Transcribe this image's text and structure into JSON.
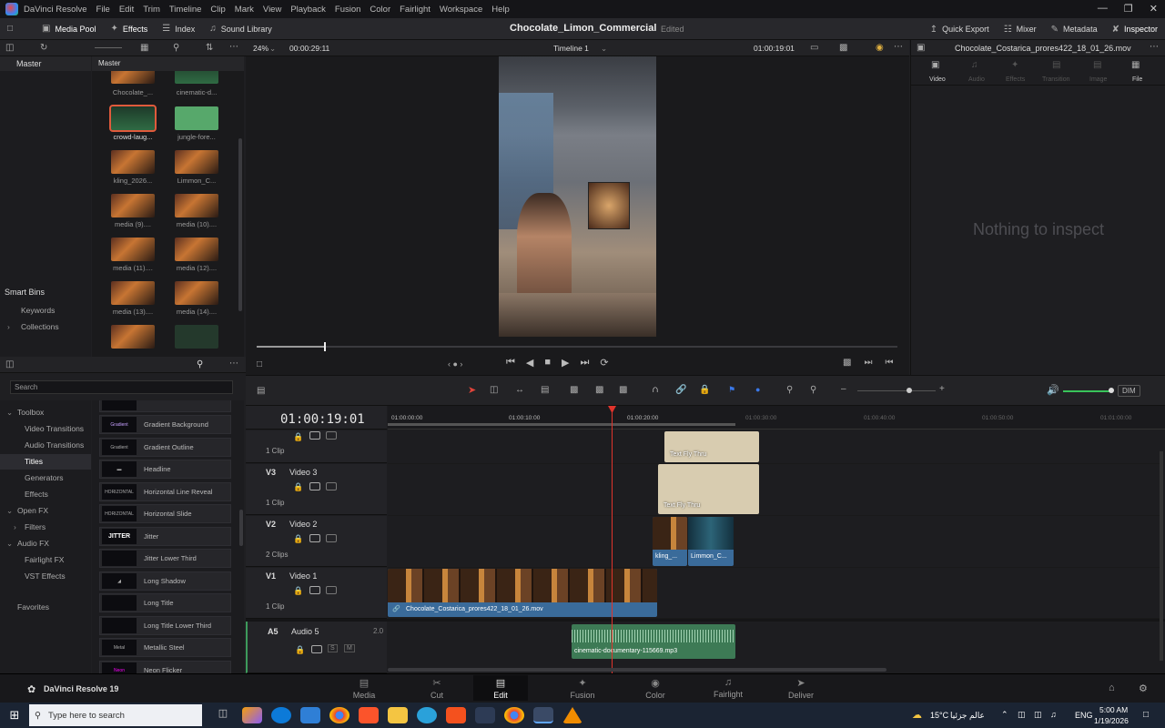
{
  "menubar": {
    "app_name": "DaVinci Resolve",
    "items": [
      "File",
      "Edit",
      "Trim",
      "Timeline",
      "Clip",
      "Mark",
      "View",
      "Playback",
      "Fusion",
      "Color",
      "Fairlight",
      "Workspace",
      "Help"
    ]
  },
  "toolbar": {
    "media_pool": "Media Pool",
    "effects": "Effects",
    "index": "Index",
    "sound_library": "Sound Library",
    "project_title": "Chocolate_Limon_Commercial",
    "project_status": "Edited",
    "quick_export": "Quick Export",
    "mixer": "Mixer",
    "metadata": "Metadata",
    "inspector": "Inspector"
  },
  "viewer": {
    "zoom": "24%",
    "duration": "00:00:29:11",
    "timeline_name": "Timeline 1",
    "timecode": "01:00:19:01",
    "playhead_fraction": 0.105
  },
  "inspector": {
    "clip_name": "Chocolate_Costarica_prores422_18_01_26.mov",
    "tabs": [
      "Video",
      "Audio",
      "Effects",
      "Transition",
      "Image",
      "File"
    ],
    "empty_message": "Nothing to inspect"
  },
  "media_pool": {
    "bin_header": "Master",
    "grid_header": "Master",
    "smart_bins": "Smart Bins",
    "keywords": "Keywords",
    "collections": "Collections",
    "clips": [
      "Chocolate_...",
      "cinematic-d...",
      "crowd-laug...",
      "jungle-fore...",
      "kling_2026...",
      "Limmon_C...",
      "media (9)....",
      "media (10)....",
      "media (11)....",
      "media (12)....",
      "media (13)....",
      "media (14)...."
    ]
  },
  "effects": {
    "search_placeholder": "Search",
    "tree": [
      "Toolbox",
      "Video Transitions",
      "Audio Transitions",
      "Titles",
      "Generators",
      "Effects",
      "Open FX",
      "Filters",
      "Audio FX",
      "Fairlight FX",
      "VST Effects",
      "Favorites"
    ],
    "items": [
      "Gradient Background",
      "Gradient Outline",
      "Headline",
      "Horizontal Line Reveal",
      "Horizontal Slide",
      "Jitter",
      "Jitter Lower Third",
      "Long Shadow",
      "Long Title",
      "Long Title Lower Third",
      "Metallic Steel",
      "Neon Flicker"
    ]
  },
  "timeline": {
    "timecode": "01:00:19:01",
    "ruler": [
      "01:00:00:00",
      "01:00:10:00",
      "01:00:20:00",
      "01:00:30:00",
      "01:00:40:00",
      "01:00:50:00",
      "01:01:00:00"
    ],
    "tracks": [
      {
        "id": "",
        "name": "",
        "clips": "1 Clip"
      },
      {
        "id": "V3",
        "name": "Video 3",
        "clips": "1 Clip"
      },
      {
        "id": "V2",
        "name": "Video 2",
        "clips": "2 Clips"
      },
      {
        "id": "V1",
        "name": "Video 1",
        "clips": "1 Clip"
      },
      {
        "id": "A5",
        "name": "Audio 5",
        "clips": "2.0"
      }
    ],
    "clip_labels": {
      "title1": "Text Fly Thru",
      "title2": "Text Fly Thru",
      "v2a": "kling_...",
      "v2b": "Limmon_C...",
      "v1": "Chocolate_Costarica_prores422_18_01_26.mov",
      "a5": "cinematic-documentary-115669.mp3"
    },
    "dim": "DIM"
  },
  "pages": {
    "app_version": "DaVinci Resolve 19",
    "tabs": [
      "Media",
      "Cut",
      "Edit",
      "Fusion",
      "Color",
      "Fairlight",
      "Deliver"
    ],
    "active": "Edit"
  },
  "taskbar": {
    "search_placeholder": "Type here to search",
    "weather": "15°C",
    "weather_text": "عالم جزئيا",
    "lang": "ENG",
    "time": "5:00 AM",
    "date": "1/19/2026"
  },
  "colors": {
    "accent": "#e05a3c",
    "playhead": "#e0342c",
    "audio_clip": "#3d7a55",
    "video_clip": "#3a6b9a",
    "title_clip": "#d8ccb0"
  }
}
